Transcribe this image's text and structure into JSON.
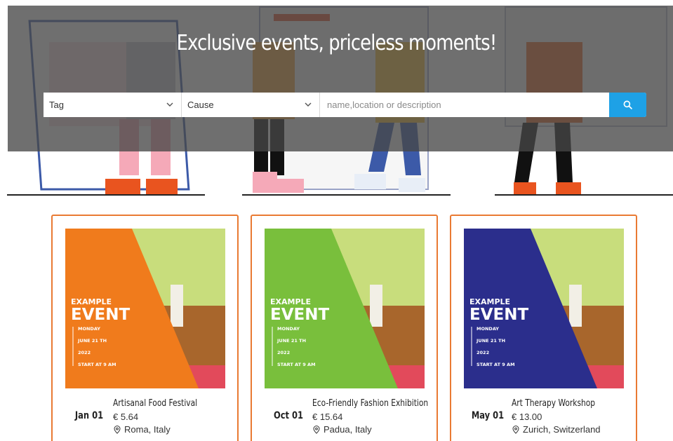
{
  "hero": {
    "title": "Exclusive events, priceless moments!"
  },
  "search": {
    "tag_label": "Tag",
    "cause_label": "Cause",
    "placeholder": "name,location or description",
    "button_icon": "search-icon"
  },
  "colors": {
    "accent": "#1ea1e6",
    "card_border": "#e97a33"
  },
  "events": [
    {
      "date": "Jan 01",
      "title": "Artisanal Food Festival",
      "price": "€ 5.64",
      "location": "Roma, Italy",
      "poster_color": "#f07b1c",
      "poster": {
        "line1": "EXAMPLE",
        "line2": "EVENT",
        "day": "MONDAY",
        "date": "JUNE 21 TH",
        "year": "2022",
        "start": "START AT 9 AM"
      }
    },
    {
      "date": "Oct 01",
      "title": "Eco-Friendly Fashion Exhibition",
      "price": "€ 15.64",
      "location": "Padua, Italy",
      "poster_color": "#79bf3c",
      "poster": {
        "line1": "EXAMPLE",
        "line2": "EVENT",
        "day": "MONDAY",
        "date": "JUNE 21 TH",
        "year": "2022",
        "start": "START AT 9 AM"
      }
    },
    {
      "date": "May 01",
      "title": "Art Therapy Workshop",
      "price": "€ 13.00",
      "location": "Zurich, Switzerland",
      "poster_color": "#2b2e8c",
      "poster": {
        "line1": "EXAMPLE",
        "line2": "EVENT",
        "day": "MONDAY",
        "date": "JUNE 21 TH",
        "year": "2022",
        "start": "START AT 9 AM"
      }
    }
  ]
}
